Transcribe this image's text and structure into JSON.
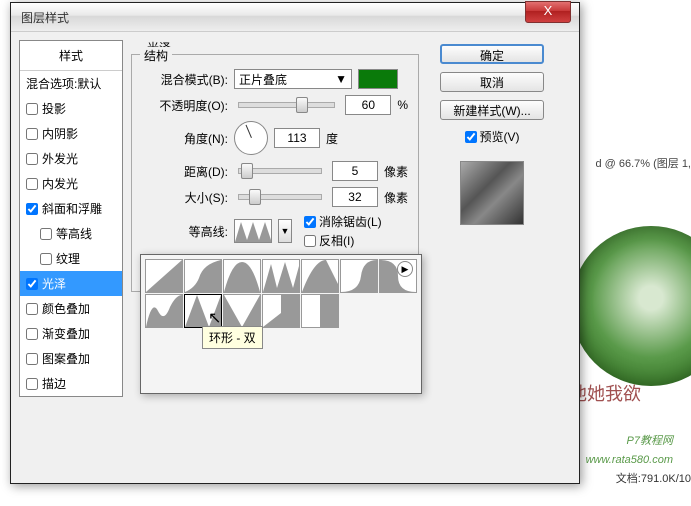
{
  "window": {
    "title": "图层样式",
    "close": "X"
  },
  "left": {
    "header": "样式",
    "blend_default": "混合选项:默认",
    "items": [
      {
        "label": "投影",
        "checked": false
      },
      {
        "label": "内阴影",
        "checked": false
      },
      {
        "label": "外发光",
        "checked": false
      },
      {
        "label": "内发光",
        "checked": false
      },
      {
        "label": "斜面和浮雕",
        "checked": true
      },
      {
        "label": "等高线",
        "checked": false,
        "indent": true
      },
      {
        "label": "纹理",
        "checked": false,
        "indent": true
      },
      {
        "label": "光泽",
        "checked": true,
        "selected": true
      },
      {
        "label": "颜色叠加",
        "checked": false
      },
      {
        "label": "渐变叠加",
        "checked": false
      },
      {
        "label": "图案叠加",
        "checked": false
      },
      {
        "label": "描边",
        "checked": false
      }
    ]
  },
  "center": {
    "group_title": "光泽",
    "struct_title": "结构",
    "blend_mode_label": "混合模式(B):",
    "blend_mode_value": "正片叠底",
    "opacity_label": "不透明度(O):",
    "opacity_value": "60",
    "opacity_unit": "%",
    "angle_label": "角度(N):",
    "angle_value": "113",
    "angle_unit": "度",
    "distance_label": "距离(D):",
    "distance_value": "5",
    "distance_unit": "像素",
    "size_label": "大小(S):",
    "size_value": "32",
    "size_unit": "像素",
    "contour_label": "等高线:",
    "antialias_label": "消除锯齿(L)",
    "invert_label": "反相(I)"
  },
  "right": {
    "ok": "确定",
    "cancel": "取消",
    "newstyle": "新建样式(W)...",
    "preview": "预览(V)"
  },
  "popup": {
    "tooltip": "环形 - 双",
    "arrow": "▶"
  },
  "bg": {
    "file": "文档:791.0K/10",
    "url": "www.rata580.com",
    "site": "P7教程网",
    "title": "d @ 66.7% (图层 1,",
    "chinese": "他她我欲"
  },
  "dropdown_arrow": "▼",
  "contour_paths": [
    "M0,32 L36,0 L36,32 Z",
    "M0,32 Q10,28 14,18 Q18,4 36,0 L36,32 Z",
    "M0,32 Q8,2 18,2 Q28,2 36,32 Z",
    "M0,32 L8,4 L14,28 L22,2 L30,28 L36,6 L36,32 Z",
    "M0,32 Q12,0 24,0 L36,24 L36,32 Z",
    "M0,32 Q18,32 20,16 Q22,0 36,0 L36,32 Z",
    "M0,32 L0,0 Q18,0 18,16 Q18,32 36,32 Z",
    "M0,32 Q6,4 12,16 Q18,28 24,12 Q30,0 36,0 L36,32 Z",
    "M0,32 L12,0 L24,32 L36,0 L36,32 Z",
    "M0,0 L18,32 L36,0 L36,32 L0,32 Z",
    "M0,32 L18,18 L18,0 L36,0 L36,32 Z",
    "M0,32 L18,32 L18,0 L36,0 L36,32 Z"
  ]
}
